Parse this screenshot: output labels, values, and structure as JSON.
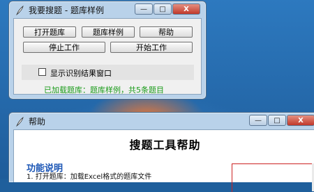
{
  "main_window": {
    "title": "我要搜题 - 题库样例",
    "buttons": {
      "open_bank": "打开题库",
      "bank_sample": "题库样例",
      "help": "帮助",
      "stop_work": "停止工作",
      "start_work": "开始工作"
    },
    "checkbox_label": "显示识别结果窗口",
    "checkbox_checked": false,
    "status": "已加载题库：题库样例，共5条题目"
  },
  "help_window": {
    "title": "帮助",
    "heading": "搜题工具帮助",
    "section_title": "功能说明",
    "line1": "1. 打开题库：加载Excel格式的题库文件"
  },
  "title_buttons": {
    "minimize": "—",
    "maximize": "□",
    "close": "X"
  },
  "colors": {
    "status_text": "#1a9b1a",
    "section_title": "#1a55b5",
    "close_button": "#c0392b"
  }
}
